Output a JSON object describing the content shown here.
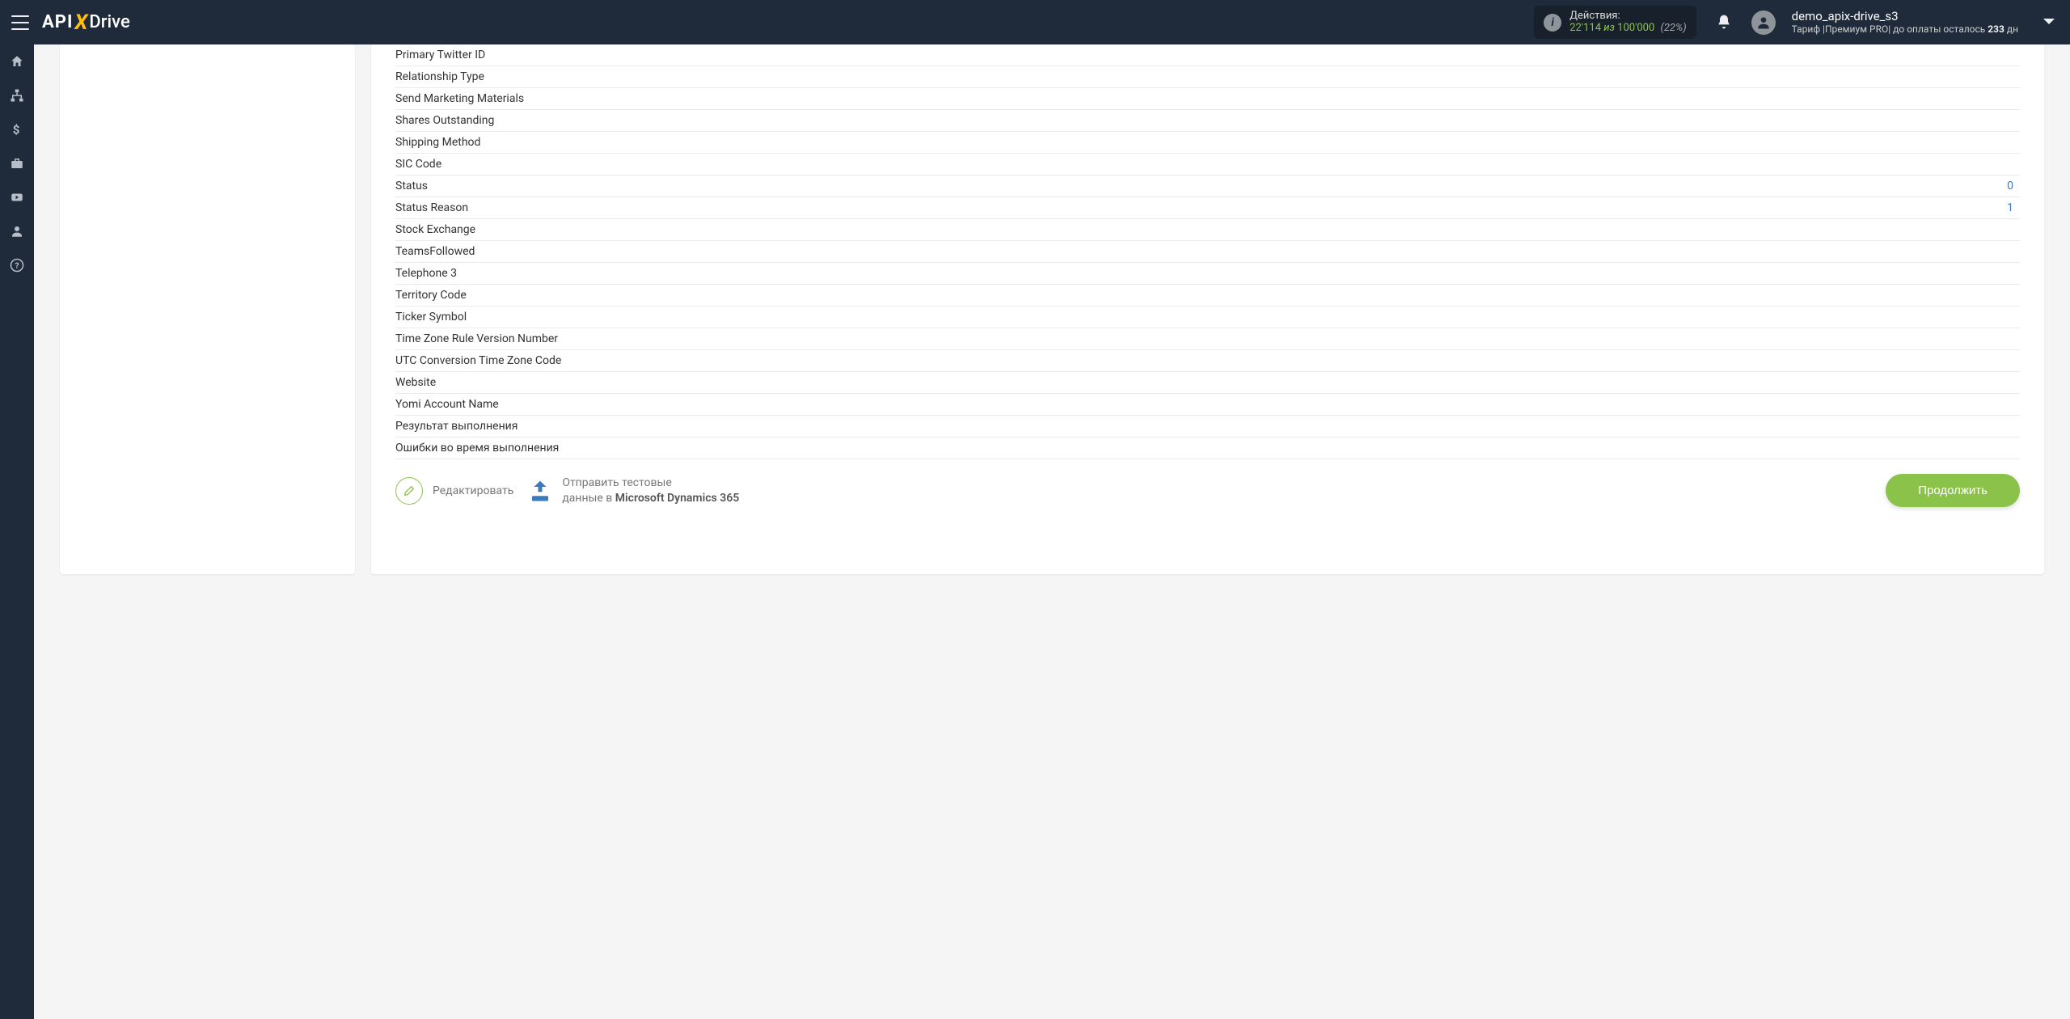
{
  "logo": {
    "part1": "API",
    "part2": "X",
    "part3": "Drive"
  },
  "header": {
    "actions_label": "Действия:",
    "actions_count": "22'114",
    "actions_of": "из",
    "actions_total": "100'000",
    "actions_pct": "(22%)",
    "user_name": "demo_apix-drive_s3",
    "tariff_prefix": "Тариф |",
    "tariff_plan": "Премиум PRO",
    "tariff_mid": "| до оплаты осталось ",
    "tariff_days": "233",
    "tariff_suffix": " дн"
  },
  "fields": [
    {
      "label": "Primary Twitter ID",
      "value": ""
    },
    {
      "label": "Relationship Type",
      "value": ""
    },
    {
      "label": "Send Marketing Materials",
      "value": ""
    },
    {
      "label": "Shares Outstanding",
      "value": ""
    },
    {
      "label": "Shipping Method",
      "value": ""
    },
    {
      "label": "SIC Code",
      "value": ""
    },
    {
      "label": "Status",
      "value": "0"
    },
    {
      "label": "Status Reason",
      "value": "1"
    },
    {
      "label": "Stock Exchange",
      "value": ""
    },
    {
      "label": "TeamsFollowed",
      "value": ""
    },
    {
      "label": "Telephone 3",
      "value": ""
    },
    {
      "label": "Territory Code",
      "value": ""
    },
    {
      "label": "Ticker Symbol",
      "value": ""
    },
    {
      "label": "Time Zone Rule Version Number",
      "value": ""
    },
    {
      "label": "UTC Conversion Time Zone Code",
      "value": ""
    },
    {
      "label": "Website",
      "value": ""
    },
    {
      "label": "Yomi Account Name",
      "value": ""
    },
    {
      "label": "Результат выполнения",
      "value": ""
    },
    {
      "label": "Ошибки во время выполнения",
      "value": ""
    }
  ],
  "actions": {
    "edit_label": "Редактировать",
    "send_line1": "Отправить тестовые",
    "send_line2_prefix": "данные в ",
    "send_target": "Microsoft Dynamics 365",
    "continue_label": "Продолжить"
  }
}
